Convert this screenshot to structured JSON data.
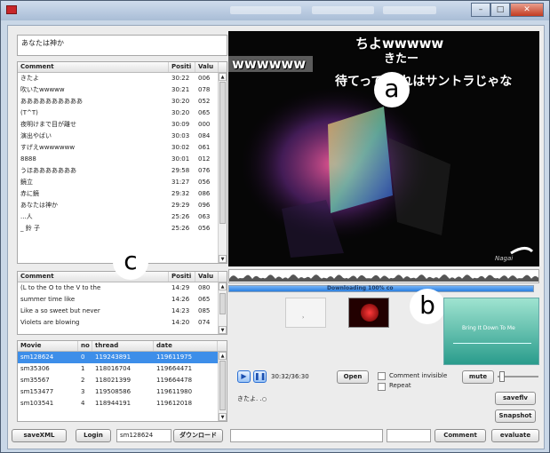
{
  "app": {
    "nickname_prompt": "あなたは神か"
  },
  "video": {
    "danmaku": [
      {
        "text": "ちよwwwww",
        "color": "#ffffff"
      },
      {
        "text": "きたー",
        "color": "#ffffff"
      },
      {
        "text": "wwwwww",
        "color": "#ffffff"
      },
      {
        "text": "待てって これはサントラじゃな",
        "color": "#ffffff"
      }
    ],
    "downloading_label": "Downloading 100% co",
    "download_progress": 1.0
  },
  "callouts": {
    "a": "a",
    "b": "b",
    "c": "c"
  },
  "comments_table": {
    "headers": [
      "Comment",
      "Positi",
      "Valu"
    ],
    "rows": [
      [
        "きたよ",
        "30:22",
        "006"
      ],
      [
        "吹いたwwwww",
        "30:21",
        "078"
      ],
      [
        "ああああああああああ",
        "30:20",
        "052"
      ],
      [
        "(T^T)",
        "30:20",
        "065"
      ],
      [
        "夜明けまで目が離せ",
        "30:09",
        "000"
      ],
      [
        "演出やばい",
        "30:03",
        "084"
      ],
      [
        "すげえwwwwwww",
        "30:02",
        "061"
      ],
      [
        "8888",
        "30:01",
        "012"
      ],
      [
        "うほあああああああ",
        "29:58",
        "076"
      ],
      [
        "鏡立",
        "31:27",
        "056"
      ],
      [
        "赤に鏡",
        "29:32",
        "086"
      ],
      [
        "あなたは神か",
        "29:29",
        "096"
      ],
      [
        "...人",
        "25:26",
        "063"
      ],
      [
        "_ 鈴 子",
        "25:26",
        "056"
      ]
    ]
  },
  "lyrics_table": {
    "headers": [
      "Comment",
      "Positi",
      "Valu"
    ],
    "rows": [
      [
        "(L to the O to the V to the",
        "14:29",
        "080"
      ],
      [
        "summer time like",
        "14:26",
        "065"
      ],
      [
        "Like a so sweet but never",
        "14:23",
        "085"
      ],
      [
        "Violets are blowing",
        "14:20",
        "074"
      ]
    ]
  },
  "movies_table": {
    "headers": [
      "Movie",
      "no",
      "thread",
      "date"
    ],
    "rows": [
      [
        "sm128624",
        "0",
        "119243891",
        "119611975"
      ],
      [
        "sm35306",
        "1",
        "118016704",
        "119664471"
      ],
      [
        "sm35567",
        "2",
        "118021399",
        "119664478"
      ],
      [
        "sm153477",
        "3",
        "119508586",
        "119611980"
      ],
      [
        "sm103541",
        "4",
        "118944191",
        "119612018"
      ]
    ],
    "selected_index": 0
  },
  "bottom_bar": {
    "save_xml": "saveXML",
    "login": "Login",
    "movie_id": "sm128624",
    "download": "ダウンロード",
    "comment_button": "Comment",
    "evaluate_button": "evaluate"
  },
  "player": {
    "time": "30:32/36:30",
    "open": "Open",
    "comment_invisible": "Comment invisible",
    "repeat": "Repeat",
    "mute": "mute",
    "volume": 0.05,
    "saveflv": "saveflv",
    "snapshot": "Snapshot",
    "status_text": "きたよ. ."
  },
  "thumbnail_caption": "Bring It Down To Me"
}
